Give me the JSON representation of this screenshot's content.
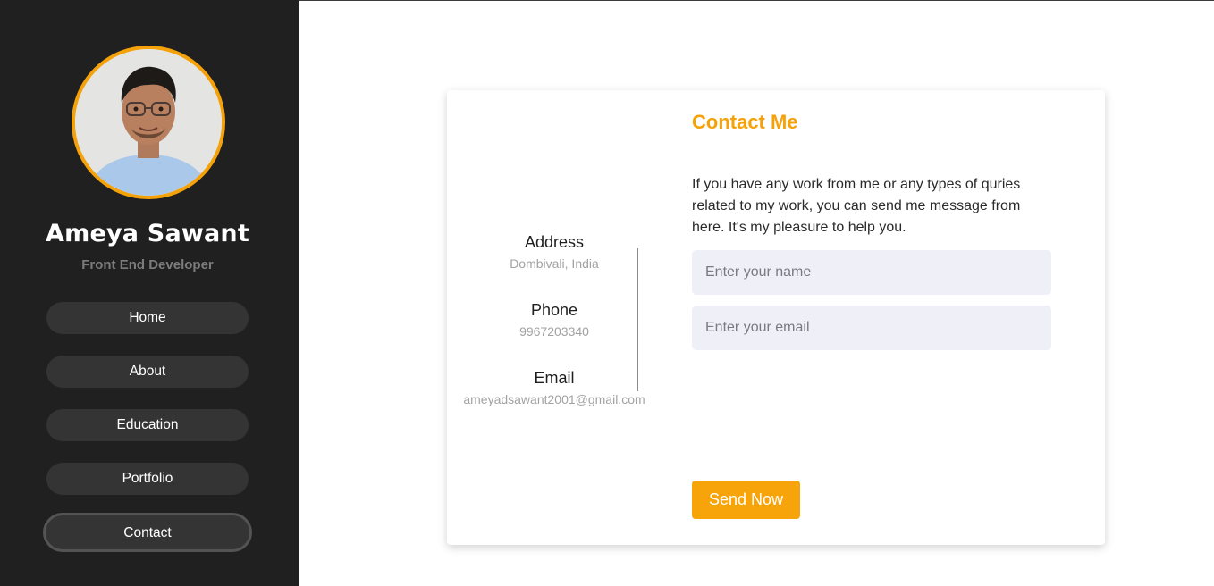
{
  "profile": {
    "name": "Ameya Sawant",
    "role": "Front End Developer"
  },
  "nav": {
    "items": [
      {
        "label": "Home"
      },
      {
        "label": "About"
      },
      {
        "label": "Education"
      },
      {
        "label": "Portfolio"
      },
      {
        "label": "Contact",
        "active": true
      }
    ]
  },
  "contact": {
    "title": "Contact Me",
    "description": "If you have any work from me or any types of quries related to my work, you can send me message from here. It's my pleasure to help you.",
    "address_label": "Address",
    "address_value": "Dombivali, India",
    "phone_label": "Phone",
    "phone_value": "9967203340",
    "email_label": "Email",
    "email_value": "ameyadsawant2001@gmail.com",
    "name_placeholder": "Enter your name",
    "email_placeholder": "Enter your email",
    "send_label": "Send Now"
  },
  "colors": {
    "accent": "#f5a20a",
    "sidebar_bg": "#202020",
    "nav_bg": "#343434",
    "input_bg": "#efeff7"
  }
}
